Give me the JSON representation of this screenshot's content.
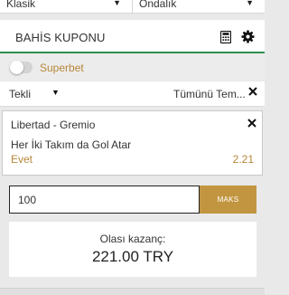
{
  "top_selects": {
    "left_value": "Klasik",
    "right_value": "Ondalık"
  },
  "header": {
    "title": "BAHİS KUPONU"
  },
  "superbet": {
    "label": "Superbet",
    "enabled": false
  },
  "mode": {
    "selected": "Tekli",
    "clear_all_label": "Tümünü Tem..."
  },
  "bet": {
    "match": "Libertad - Gremio",
    "market": "Her İki Takım da Gol Atar",
    "selection": "Evet",
    "odds": "2.21"
  },
  "stake": {
    "value": "100",
    "max_label": "MAKS"
  },
  "payout": {
    "label": "Olası kazanç:",
    "value": "221.00 TRY"
  },
  "colors": {
    "accent_gold": "#c29641",
    "text_gold": "#b8873a",
    "header_underline_green": "#2d8f4e"
  }
}
